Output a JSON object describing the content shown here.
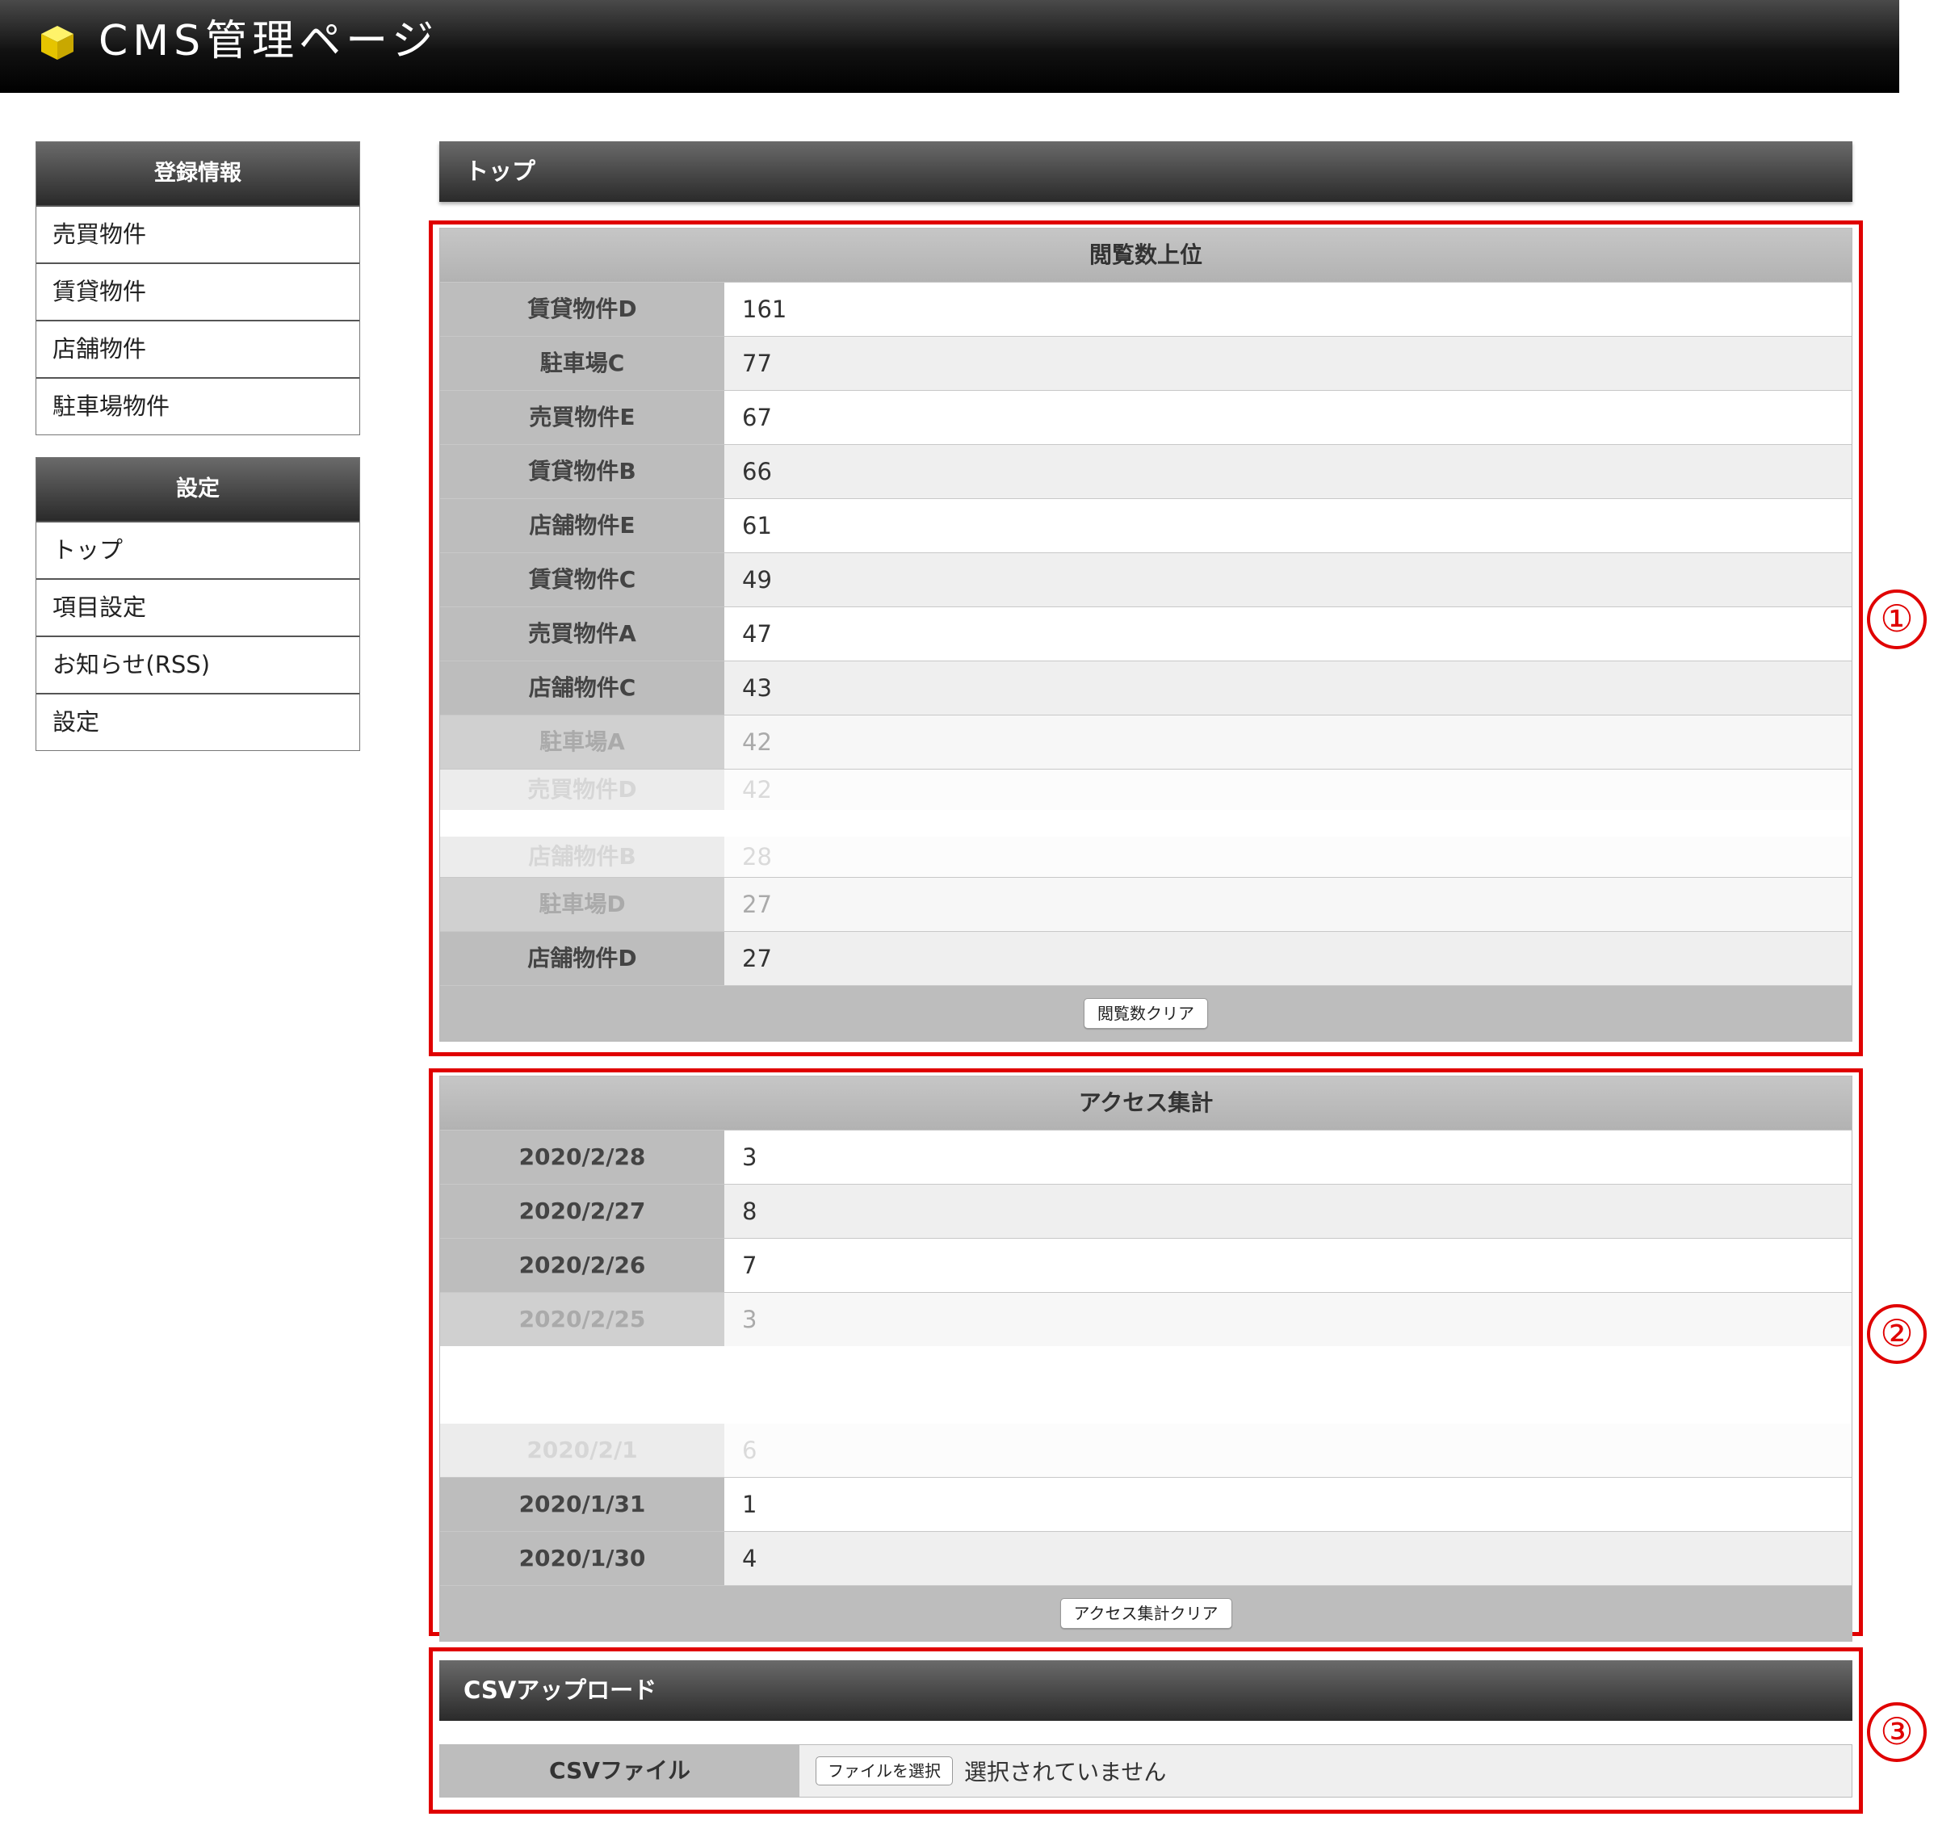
{
  "header": {
    "title": "CMS管理ページ"
  },
  "sidebar": {
    "sections": [
      {
        "title": "登録情報",
        "items": [
          "売買物件",
          "賃貸物件",
          "店舗物件",
          "駐車場物件"
        ]
      },
      {
        "title": "設定",
        "items": [
          "トップ",
          "項目設定",
          "お知らせ(RSS)",
          "設定"
        ]
      }
    ]
  },
  "page": {
    "heading": "トップ"
  },
  "views": {
    "title": "閲覧数上位",
    "rows": [
      {
        "name": "賃貸物件D",
        "count": "161"
      },
      {
        "name": "駐車場C",
        "count": "77"
      },
      {
        "name": "売買物件E",
        "count": "67"
      },
      {
        "name": "賃貸物件B",
        "count": "66"
      },
      {
        "name": "店舗物件E",
        "count": "61"
      },
      {
        "name": "賃貸物件C",
        "count": "49"
      },
      {
        "name": "売買物件A",
        "count": "47"
      },
      {
        "name": "店舗物件C",
        "count": "43"
      },
      {
        "name": "駐車場A",
        "count": "42"
      },
      {
        "name": "売買物件D",
        "count": "42"
      },
      {
        "name": "店舗物件B",
        "count": "28"
      },
      {
        "name": "駐車場D",
        "count": "27"
      },
      {
        "name": "店舗物件D",
        "count": "27"
      }
    ],
    "clear_button": "閲覧数クリア"
  },
  "access": {
    "title": "アクセス集計",
    "rows": [
      {
        "date": "2020/2/28",
        "count": "3"
      },
      {
        "date": "2020/2/27",
        "count": "8"
      },
      {
        "date": "2020/2/26",
        "count": "7"
      },
      {
        "date": "2020/2/25",
        "count": "3"
      },
      {
        "date": "2020/2/1",
        "count": "6"
      },
      {
        "date": "2020/1/31",
        "count": "1"
      },
      {
        "date": "2020/1/30",
        "count": "4"
      }
    ],
    "clear_button": "アクセス集計クリア"
  },
  "csv": {
    "heading": "CSVアップロード",
    "label": "CSVファイル",
    "file_button": "ファイルを選択",
    "file_status": "選択されていません"
  },
  "markers": [
    "①",
    "②",
    "③"
  ]
}
